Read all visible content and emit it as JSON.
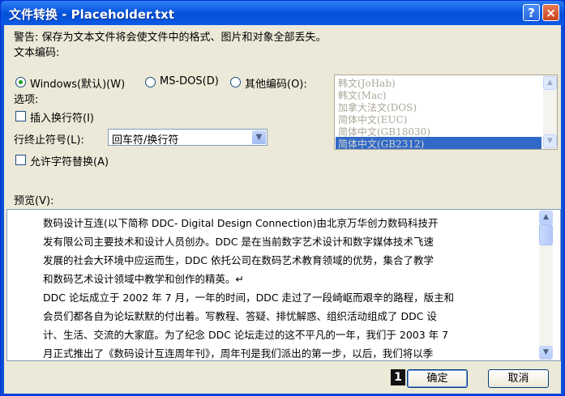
{
  "window": {
    "title": "文件转换 - Placeholder.txt",
    "help_glyph": "?",
    "close_glyph": "×"
  },
  "warning": "警告: 保存为文本文件将会使文件中的格式、图片和对象全部丢失。",
  "encoding": {
    "label": "文本编码:",
    "options": [
      {
        "label": "Windows(默认)(W)",
        "selected": true
      },
      {
        "label": "MS-DOS(D)",
        "selected": false
      },
      {
        "label": "其他编码(O):",
        "selected": false
      }
    ],
    "list": [
      "韩文(JoHab)",
      "韩文(Mac)",
      "加拿大法文(DOS)",
      "简体中文(EUC)",
      "简体中文(GB18030)",
      "简体中文(GB2312)"
    ],
    "list_selected": "简体中文(GB2312)"
  },
  "options": {
    "label": "选项:",
    "insert_linebreak": {
      "label": "插入换行符(I)",
      "checked": false
    },
    "line_end": {
      "label": "行终止符号(L):",
      "value": "回车符/换行符"
    },
    "allow_substitution": {
      "label": "允许字符替换(A)",
      "checked": false
    }
  },
  "preview": {
    "label": "预览(V):",
    "lines": [
      "数码设计互连(以下简称 DDC- Digital Design Connection)由北京万华创力数码科技开",
      "发有限公司主要技术和设计人员创办。DDC 是在当前数字艺术设计和数字媒体技术飞速",
      "发展的社会大环境中应运而生，DDC 依托公司在数码艺术教育领域的优势，集合了教学",
      "和数码艺术设计领域中教学和创作的精英。↵",
      "DDC 论坛成立于 2002 年 7 月，一年的时间，DDC 走过了一段崎岖而艰辛的路程，版主和",
      "会员们都各自为论坛默默的付出着。写教程、答疑、排忧解惑、组织活动组成了 DDC 设",
      "计、生活、交流的大家庭。为了纪念 DDC 论坛走过的这不平凡的一年，我们于 2003 年 7",
      "月正式推出了《数码设计互连周年刊》，周年刊是我们派出的第一步，以后，我们将以季"
    ]
  },
  "buttons": {
    "ok": "确定",
    "cancel": "取消"
  },
  "badge": "1",
  "colors": {
    "titlebar": "#0a58e0",
    "dialog_bg": "#ece9d8",
    "selection": "#3169c6"
  }
}
